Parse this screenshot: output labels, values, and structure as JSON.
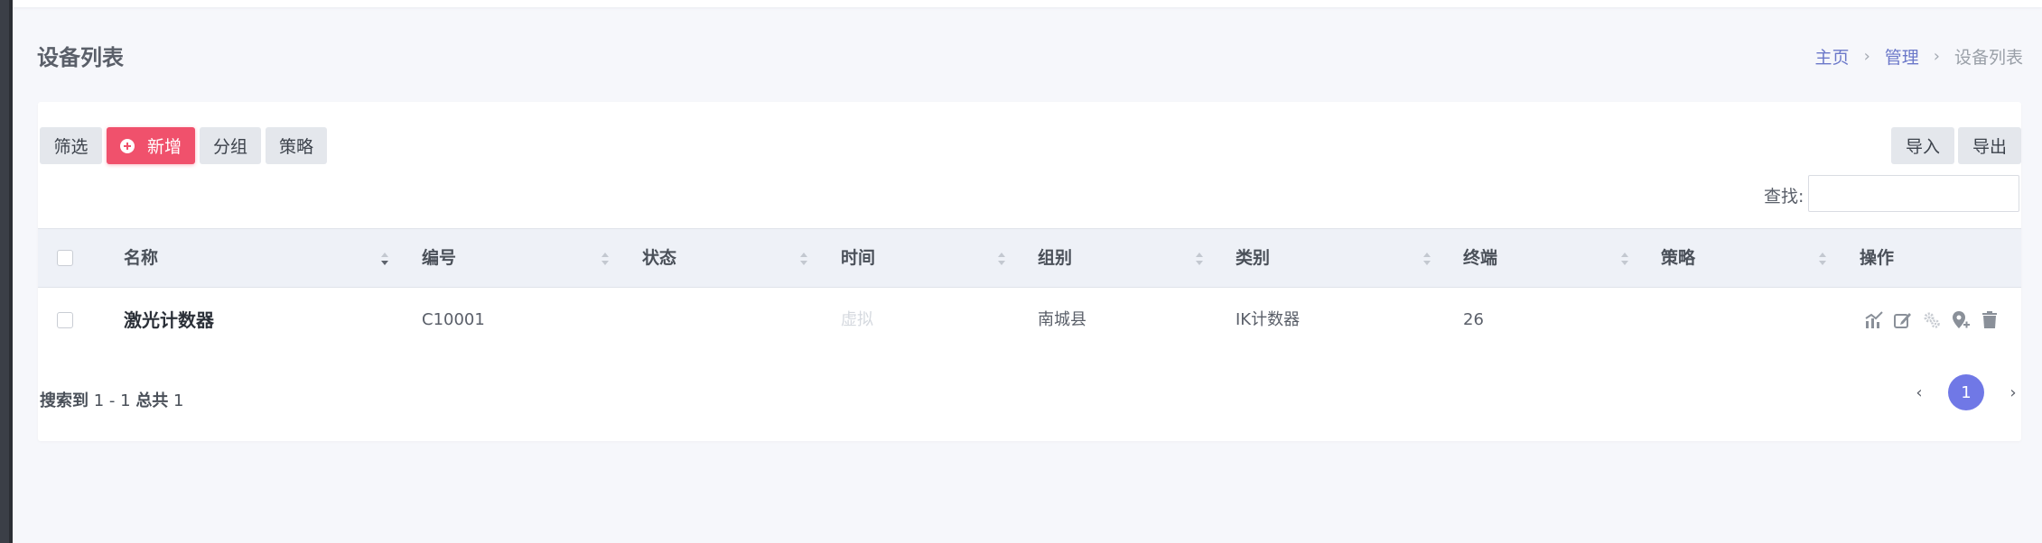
{
  "page": {
    "title": "设备列表"
  },
  "breadcrumb": {
    "home": "主页",
    "sep": "›",
    "manage": "管理",
    "current": "设备列表"
  },
  "toolbar": {
    "filter": "筛选",
    "add": "新增",
    "group": "分组",
    "strategy": "策略",
    "import": "导入",
    "export": "导出",
    "search_label": "查找:",
    "search_value": ""
  },
  "table": {
    "headers": [
      "名称",
      "编号",
      "状态",
      "时间",
      "组别",
      "类别",
      "终端",
      "策略",
      "操作"
    ],
    "rows": [
      {
        "name": "激光计数器",
        "code": "C10001",
        "status": "",
        "time": "虚拟",
        "group": "南城县",
        "category": "IK计数器",
        "terminal": "26",
        "strategy": ""
      }
    ],
    "action_icons": [
      "chart-icon",
      "edit-icon",
      "settings-icon",
      "add-location-icon",
      "trash-icon"
    ]
  },
  "pagination": {
    "summary_prefix": "搜索到",
    "range": "1 - 1",
    "total_label": "总共",
    "total": "1",
    "prev": "‹",
    "current_page": "1",
    "next": "›"
  },
  "colors": {
    "primary_button": "#f0516c",
    "active_page": "#7078e6",
    "breadcrumb_link": "#6b78c9"
  }
}
